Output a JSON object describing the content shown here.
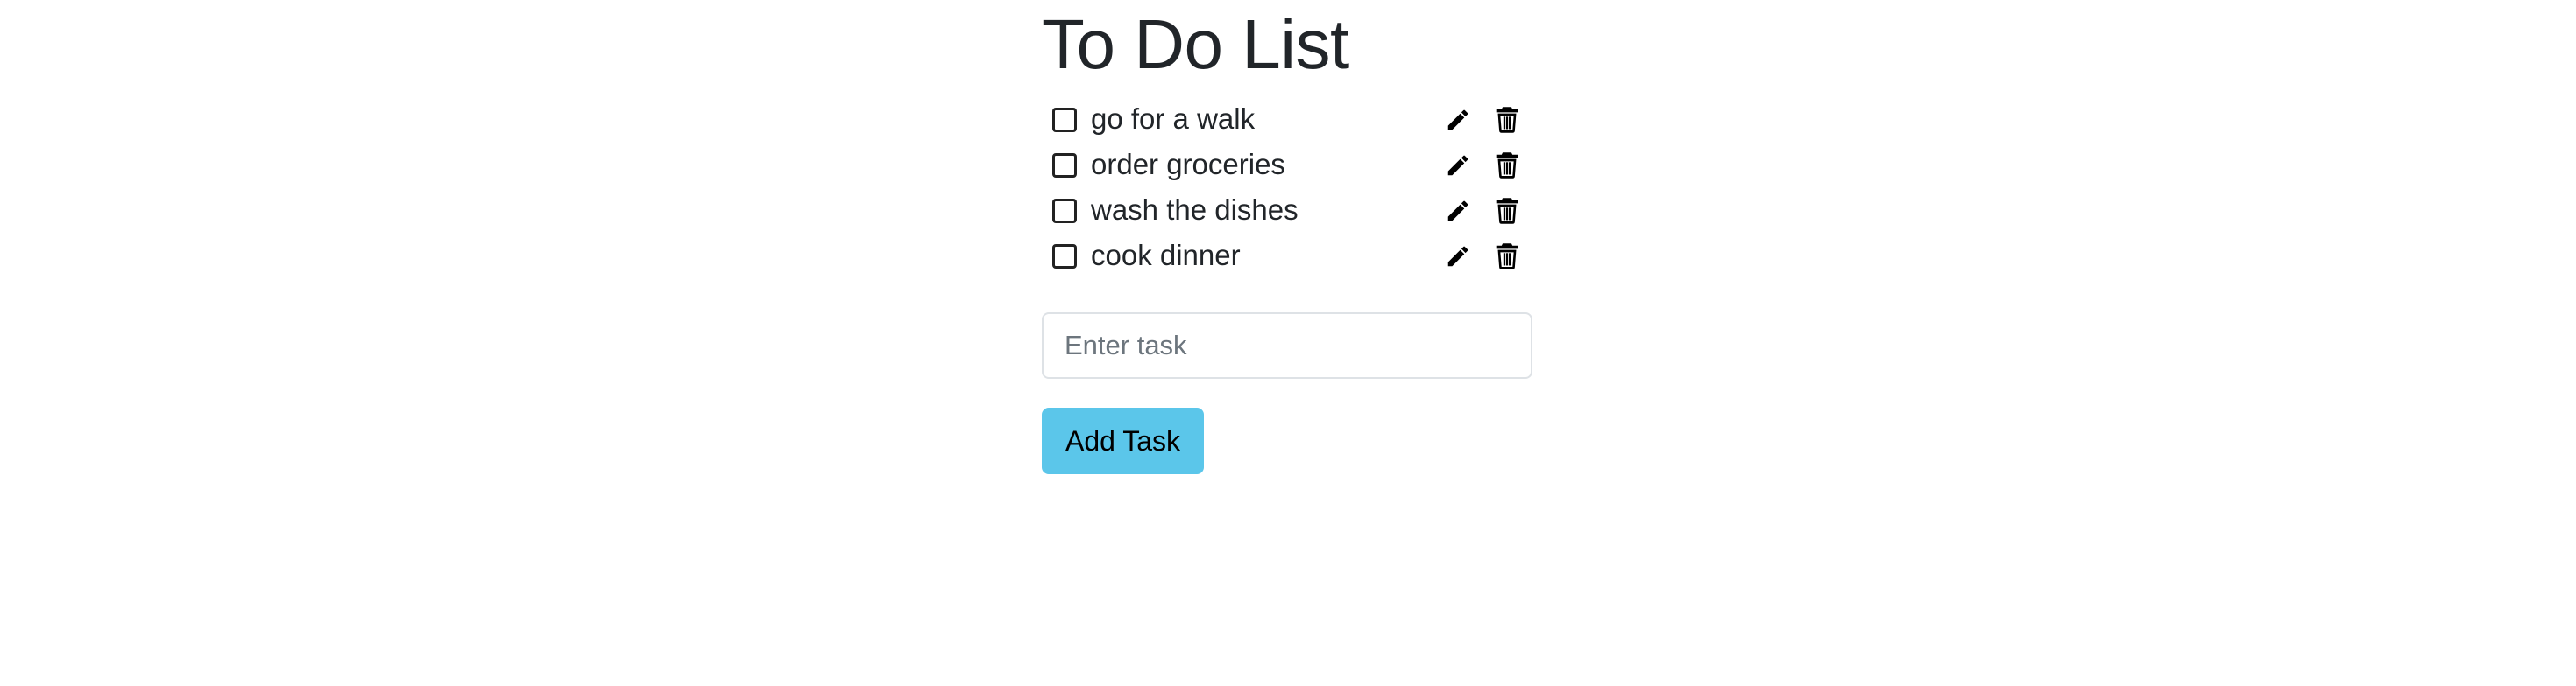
{
  "page": {
    "title": "To Do List"
  },
  "tasks": [
    {
      "label": "go for a walk",
      "checked": false
    },
    {
      "label": "order groceries",
      "checked": false
    },
    {
      "label": "wash the dishes",
      "checked": false
    },
    {
      "label": "cook dinner",
      "checked": false
    }
  ],
  "task_actions": {
    "edit_icon": "pencil-icon",
    "delete_icon": "trash-icon"
  },
  "form": {
    "input_value": "",
    "input_placeholder": "Enter task",
    "add_button_label": "Add Task"
  },
  "colors": {
    "button_background": "#5bc6ea",
    "title_text": "#212529",
    "input_border": "#dee2e6"
  }
}
